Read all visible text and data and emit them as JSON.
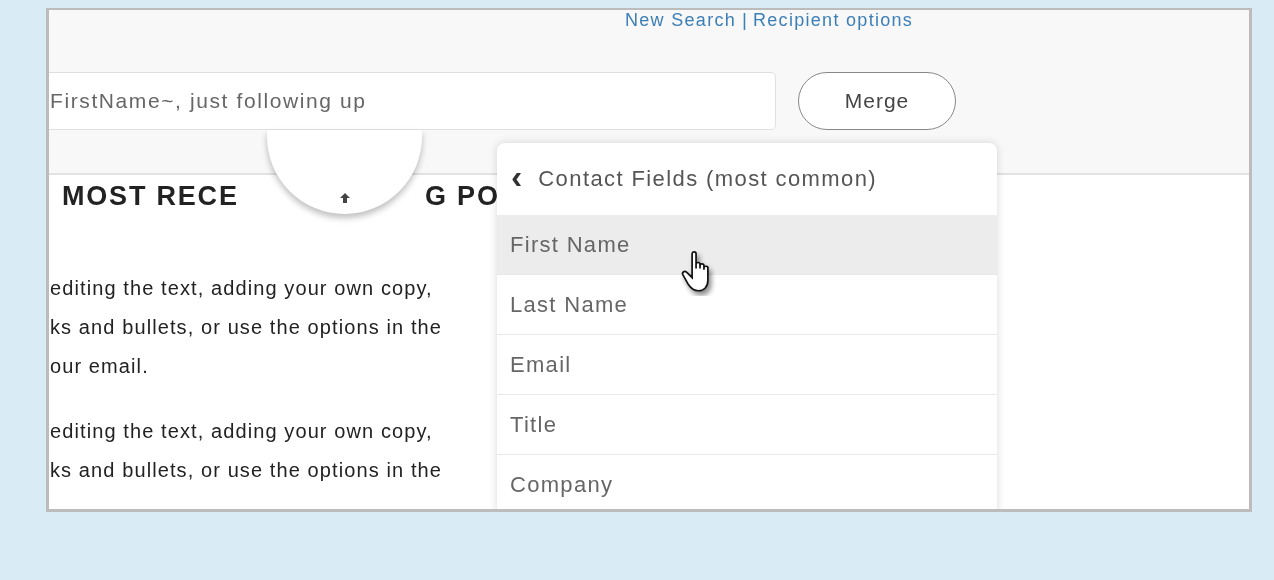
{
  "header_links": [
    {
      "label": "New Search"
    },
    {
      "label": "Recipient options"
    }
  ],
  "link_separator": "|",
  "subject_field": {
    "value": "FirstName~, just following up"
  },
  "merge_button": {
    "label": "Merge"
  },
  "heading_parts": [
    "MOST RECE",
    "G PO"
  ],
  "paragraphs": [
    [
      "editing the text, adding your own copy,",
      "ks and bullets, or use the options in the",
      "our email."
    ],
    [
      "editing the text, adding your own copy,",
      "ks and bullets, or use the options in the"
    ]
  ],
  "dropdown": {
    "back_glyph": "‹",
    "title": "Contact Fields (most common)",
    "items": [
      {
        "label": "First Name",
        "selected": true
      },
      {
        "label": "Last Name",
        "selected": false
      },
      {
        "label": "Email",
        "selected": false
      },
      {
        "label": "Title",
        "selected": false
      },
      {
        "label": "Company",
        "selected": false
      }
    ]
  }
}
